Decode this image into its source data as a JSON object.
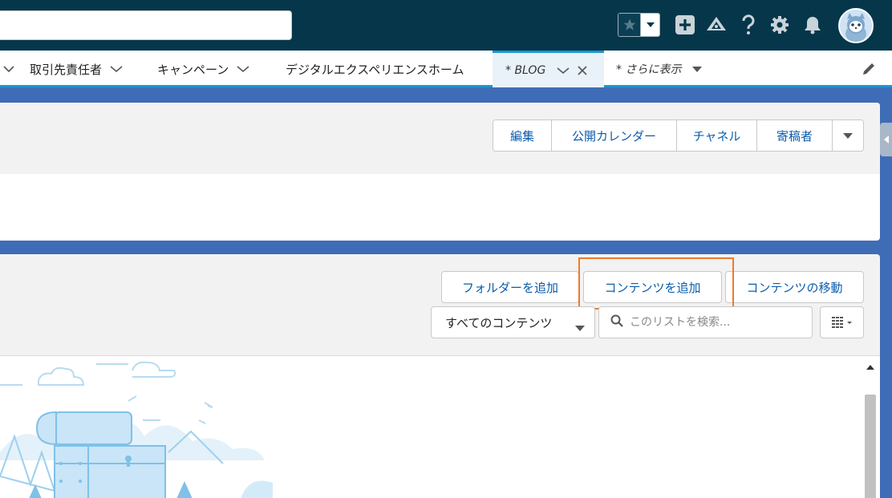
{
  "header": {
    "search_placeholder": "",
    "icons": [
      "star-icon",
      "chevron-down-icon",
      "add-icon",
      "trailhead-icon",
      "help-icon",
      "settings-icon",
      "bell-icon",
      "avatar"
    ]
  },
  "nav": {
    "items": [
      {
        "label": "取引先責任者"
      },
      {
        "label": "キャンペーン"
      },
      {
        "label": "デジタルエクスペリエンスホーム"
      },
      {
        "label": "* BLOG"
      },
      {
        "label": "* さらに表示"
      }
    ]
  },
  "record_header": {
    "buttons": [
      "編集",
      "公開カレンダー",
      "チャネル",
      "寄稿者"
    ]
  },
  "content_list": {
    "buttons": [
      "フォルダーを追加",
      "コンテンツを追加",
      "コンテンツの移動"
    ],
    "filter_value": "すべてのコンテンツ",
    "search_placeholder": "このリストを検索..."
  },
  "colors": {
    "header_bg": "#05364a",
    "nav_accent": "#1b96d1",
    "highlight": "#f07a2c",
    "background": "#3f6cb6"
  }
}
